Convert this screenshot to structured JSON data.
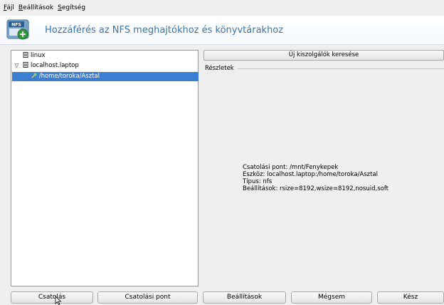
{
  "menu": {
    "items": [
      {
        "underline": "F",
        "rest": "ájl"
      },
      {
        "underline": "B",
        "rest": "eállítások"
      },
      {
        "underline": "S",
        "rest": "egítség"
      }
    ]
  },
  "header": {
    "title": "Hozzáférés az NFS meghajtókhoz és könyvtárakhoz",
    "icon_label": "NFS",
    "icon_name": "nfs-share-add-icon"
  },
  "tree": {
    "items": [
      {
        "label": "linux",
        "expander": "",
        "icon": "host-icon"
      },
      {
        "label": "localhost.laptop",
        "expander": "▽",
        "icon": "host-icon"
      },
      {
        "label": "/home/toroka/Asztal",
        "expander": "",
        "icon": "share-icon",
        "selected": true
      }
    ]
  },
  "right": {
    "search_button": "Új kiszolgálók keresése",
    "details_title": "Részletek",
    "details": [
      "Csatolási pont: /mnt/Fenykepek",
      "Eszköz: localhost.laptop:/home/toroka/Asztal",
      "Típus: nfs",
      "Beállítások: rsize=8192,wsize=8192,nosuid,soft"
    ]
  },
  "buttons": {
    "mount": "Csatolás",
    "mount_point": "Csatolási pont",
    "settings": "Beállítások",
    "cancel": "Mégsem",
    "done": "Kész"
  },
  "colors": {
    "accent": "#3c7fd0",
    "title": "#3a74a8"
  }
}
